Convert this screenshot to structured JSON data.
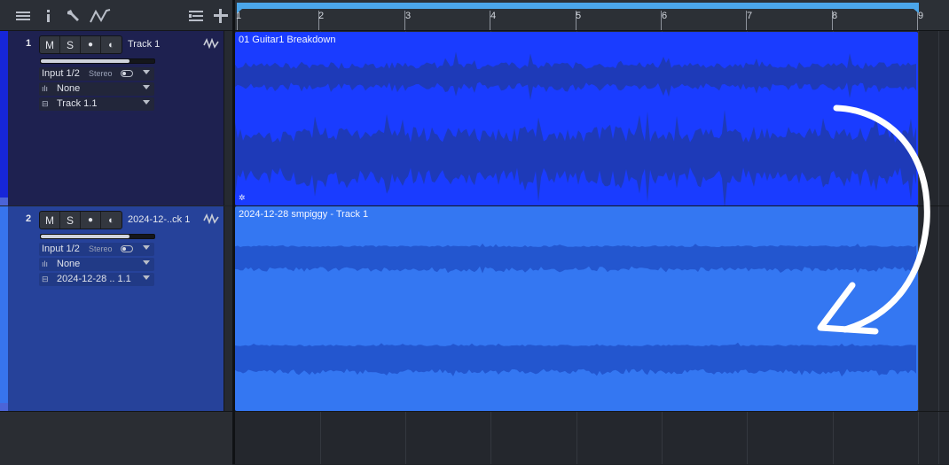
{
  "colors": {
    "track1_clip": "#1a3cff",
    "track1_wave": "#1e3ab8",
    "track2_clip": "#3477f2",
    "track2_wave": "#2356cf",
    "track1_panel": "#1e2150",
    "track2_panel": "#26429a",
    "loop_bar": "#4ba6ea",
    "annotation_arrow": "#ffffff"
  },
  "toolbar": {
    "icons": [
      "list-icon",
      "info-icon",
      "wrench-icon",
      "automation-icon",
      "track-list-icon",
      "add-icon"
    ]
  },
  "ruler": {
    "bars": [
      "1",
      "2",
      "3",
      "4",
      "5",
      "6",
      "7",
      "8",
      "9"
    ]
  },
  "tracks": [
    {
      "number": "1",
      "buttons": [
        "M",
        "S",
        "●",
        "◐"
      ],
      "name": "Track 1",
      "fader_level": 0.78,
      "input": "Input 1/2",
      "input_mode": "Stereo",
      "insert": "None",
      "output": "Track 1.1",
      "clip_title": "01 Guitar1 Breakdown"
    },
    {
      "number": "2",
      "buttons": [
        "M",
        "S",
        "●",
        "◐"
      ],
      "name": "2024-12-..ck 1",
      "fader_level": 0.78,
      "input": "Input 1/2",
      "input_mode": "Stereo",
      "insert": "None",
      "output": "2024-12-28 .. 1.1",
      "clip_title": "2024-12-28 smpiggy - Track 1"
    }
  ]
}
